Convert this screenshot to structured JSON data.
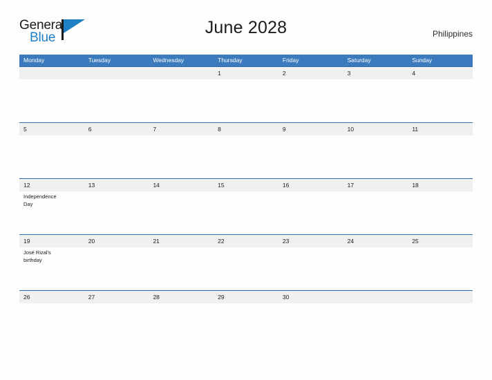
{
  "brand": {
    "name_part1": "General",
    "name_part2": "Blue",
    "flag_icon": "blue-flag-icon",
    "color_dark": "#1b1b1b",
    "color_blue": "#1f7fc4"
  },
  "header": {
    "title": "June 2028",
    "country": "Philippines"
  },
  "theme": {
    "header_blue": "#3a7abd",
    "row_line_blue": "#2d6ca8",
    "number_band_gray": "#f0f0f0",
    "page_background": "#fdfdfd"
  },
  "calendar": {
    "month": "June",
    "year": "2028",
    "week_start": "Monday",
    "day_headers": [
      "Monday",
      "Tuesday",
      "Wednesday",
      "Thursday",
      "Friday",
      "Saturday",
      "Sunday"
    ],
    "weeks": [
      {
        "cells": [
          {
            "day": "",
            "event": ""
          },
          {
            "day": "",
            "event": ""
          },
          {
            "day": "",
            "event": ""
          },
          {
            "day": "1",
            "event": ""
          },
          {
            "day": "2",
            "event": ""
          },
          {
            "day": "3",
            "event": ""
          },
          {
            "day": "4",
            "event": ""
          }
        ]
      },
      {
        "cells": [
          {
            "day": "5",
            "event": ""
          },
          {
            "day": "6",
            "event": ""
          },
          {
            "day": "7",
            "event": ""
          },
          {
            "day": "8",
            "event": ""
          },
          {
            "day": "9",
            "event": ""
          },
          {
            "day": "10",
            "event": ""
          },
          {
            "day": "11",
            "event": ""
          }
        ]
      },
      {
        "cells": [
          {
            "day": "12",
            "event": "Independence Day"
          },
          {
            "day": "13",
            "event": ""
          },
          {
            "day": "14",
            "event": ""
          },
          {
            "day": "15",
            "event": ""
          },
          {
            "day": "16",
            "event": ""
          },
          {
            "day": "17",
            "event": ""
          },
          {
            "day": "18",
            "event": ""
          }
        ]
      },
      {
        "cells": [
          {
            "day": "19",
            "event": "José Rizal's birthday"
          },
          {
            "day": "20",
            "event": ""
          },
          {
            "day": "21",
            "event": ""
          },
          {
            "day": "22",
            "event": ""
          },
          {
            "day": "23",
            "event": ""
          },
          {
            "day": "24",
            "event": ""
          },
          {
            "day": "25",
            "event": ""
          }
        ]
      },
      {
        "cells": [
          {
            "day": "26",
            "event": ""
          },
          {
            "day": "27",
            "event": ""
          },
          {
            "day": "28",
            "event": ""
          },
          {
            "day": "29",
            "event": ""
          },
          {
            "day": "30",
            "event": ""
          },
          {
            "day": "",
            "event": ""
          },
          {
            "day": "",
            "event": ""
          }
        ]
      }
    ]
  }
}
